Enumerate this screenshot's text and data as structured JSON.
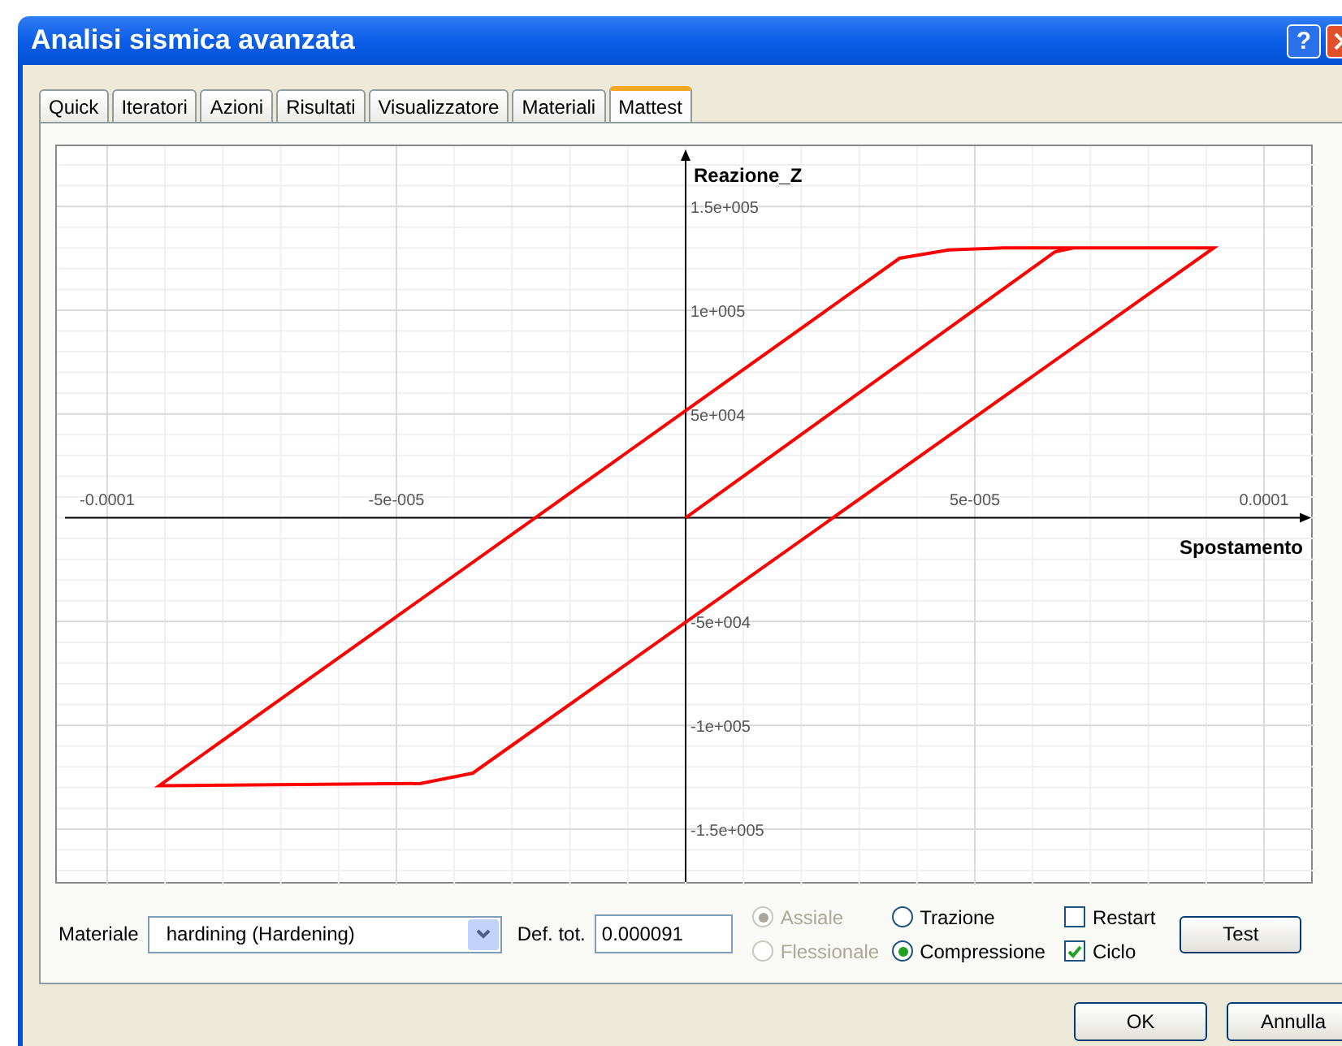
{
  "window": {
    "title": "Analisi sismica avanzata",
    "help_button": "?"
  },
  "tabs": [
    {
      "label": "Quick",
      "selected": false
    },
    {
      "label": "Iteratori",
      "selected": false
    },
    {
      "label": "Azioni",
      "selected": false
    },
    {
      "label": "Risultati",
      "selected": false
    },
    {
      "label": "Visualizzatore",
      "selected": false
    },
    {
      "label": "Materiali",
      "selected": false
    },
    {
      "label": "Mattest",
      "selected": true
    }
  ],
  "chart": {
    "chart_data": {
      "type": "line",
      "xlabel": "Spostamento",
      "ylabel": "Reazione_Z",
      "xlim": [
        -0.0001087,
        0.0001087
      ],
      "ylim": [
        -177000,
        179000
      ],
      "xticks": [
        {
          "value": -0.0001,
          "label": "-0.0001"
        },
        {
          "value": -5e-05,
          "label": "-5e-005"
        },
        {
          "value": 5e-05,
          "label": "5e-005"
        },
        {
          "value": 0.0001,
          "label": "0.0001"
        }
      ],
      "yticks": [
        {
          "value": 150000,
          "label": "1.5e+005"
        },
        {
          "value": 100000,
          "label": "1e+005"
        },
        {
          "value": 50000,
          "label": "5e+004"
        },
        {
          "value": -50000,
          "label": "-5e+004"
        },
        {
          "value": -100000,
          "label": "-1e+005"
        },
        {
          "value": -150000,
          "label": "-1.5e+005"
        }
      ],
      "x": [
        0,
        6.38e-05,
        6.7e-05,
        9.13e-05,
        -3.68e-05,
        -4.58e-05,
        -9.1e-05,
        3.7e-05,
        4.55e-05,
        5.5e-05,
        9.13e-05
      ],
      "grid": true,
      "series": [
        {
          "color": "#ff0000",
          "values": [
            0,
            128000,
            130000,
            130000,
            -123000,
            -128000,
            -129000,
            125000,
            129000,
            130000,
            130000
          ]
        }
      ]
    }
  },
  "controls": {
    "material_label": "Materiale",
    "material_value": "hardining (Hardening)",
    "def_label": "Def. tot.",
    "def_value": "0.000091",
    "mode_options": [
      {
        "label": "Assiale",
        "selected": true,
        "disabled": true
      },
      {
        "label": "Flessionale",
        "selected": false,
        "disabled": true
      }
    ],
    "direction_options": [
      {
        "label": "Trazione",
        "selected": false,
        "disabled": false
      },
      {
        "label": "Compressione",
        "selected": true,
        "disabled": false
      }
    ],
    "checkboxes": [
      {
        "label": "Restart",
        "checked": false
      },
      {
        "label": "Ciclo",
        "checked": true
      }
    ],
    "test_button": "Test"
  },
  "buttons": [
    "OK",
    "Annulla"
  ]
}
